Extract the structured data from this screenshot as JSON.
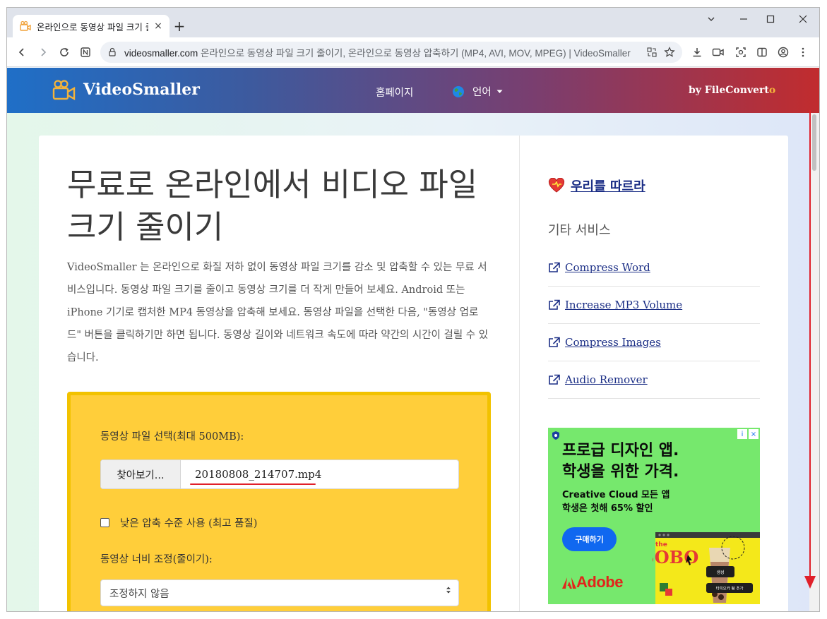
{
  "browser": {
    "tab_title": "온라인으로 동영상 파일 크기 줄이기",
    "url_domain": "videosmaller.com",
    "url_rest": " 온라인으로 동영상 파일 크기 줄이기, 온라인으로 동영상 압축하기 (MP4, AVI, MOV, MPEG) | VideoSmaller",
    "new_tab_symbol": "+",
    "tab_close_symbol": "×"
  },
  "header": {
    "logo_text": "VideoSmaller",
    "nav_home": "홈페이지",
    "nav_language": "언어",
    "by_prefix": "by FileConvert",
    "by_accent": "o"
  },
  "main": {
    "title": "무료로 온라인에서 비디오 파일 크기 줄이기",
    "intro": "VideoSmaller 는 온라인으로 화질 저하 없이 동영상 파일 크기를 감소 및 압축할 수 있는 무료 서비스입니다. 동영상 파일 크기를 줄이고 동영상 크기를 더 작게 만들어 보세요. Android 또는 iPhone 기기로 캡처한 MP4 동영상을 압축해 보세요. 동영상 파일을 선택한 다음, \"동영상 업로드\" 버튼을 클릭하기만 하면 됩니다. 동영상 길이와 네트워크 속도에 따라 약간의 시간이 걸릴 수 있습니다.",
    "form": {
      "file_label": "동영상 파일 선택(최대 500MB):",
      "browse_button": "찾아보기...",
      "file_name": "20180808_214707.mp4",
      "low_compression_label": "낮은 압축 수준 사용 (최고 품질)",
      "low_compression_checked": false,
      "width_label": "동영상 너비 조정(줄이기):",
      "width_selected": "조정하지 않음"
    }
  },
  "sidebar": {
    "follow_link": "우리를 따르라",
    "other_services_title": "기타 서비스",
    "services": [
      {
        "label": "Compress Word"
      },
      {
        "label": "Increase MP3 Volume"
      },
      {
        "label": "Compress Images"
      },
      {
        "label": "Audio Remover"
      }
    ]
  },
  "ad": {
    "headline_1": "프로급 디자인 앱.",
    "headline_2": "학생을 위한 가격.",
    "sub_1": "Creative Cloud 모든 앱",
    "sub_2": "학생은 첫해 65% 할인",
    "button": "구매하기",
    "brand": "Adobe",
    "art_word": "BOBO",
    "art_small": "the",
    "popup_1": "생성",
    "popup_2": "타피오카 펄 추가",
    "info_symbol": "i",
    "close_symbol": "×"
  },
  "colors": {
    "header_start": "#1f6fc7",
    "header_end": "#c12c2e",
    "form_bg": "#ffce3a",
    "link": "#1c2f86",
    "ad_bg": "#76e86d",
    "annotation_red": "#e0202a"
  }
}
